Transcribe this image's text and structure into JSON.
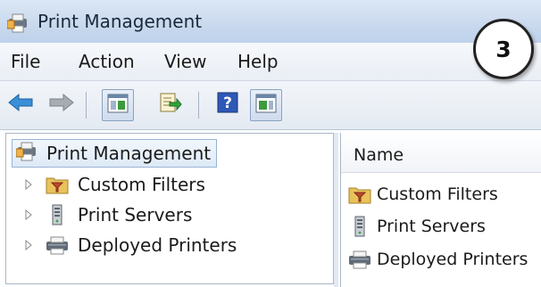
{
  "window": {
    "title": "Print Management"
  },
  "badge": {
    "number": "3"
  },
  "menu": {
    "items": [
      "File",
      "Action",
      "View",
      "Help"
    ]
  },
  "toolbar": {
    "buttons": [
      "back-arrow-icon",
      "forward-arrow-icon",
      "show-hide-console-tree-icon",
      "export-list-icon",
      "help-icon",
      "show-hide-action-pane-icon"
    ]
  },
  "tree": {
    "root": "Print Management",
    "children": [
      "Custom Filters",
      "Print Servers",
      "Deployed Printers"
    ]
  },
  "list": {
    "column_header": "Name",
    "items": [
      "Custom Filters",
      "Print Servers",
      "Deployed Printers"
    ]
  },
  "colors": {
    "titlebar": "#c9d9ee",
    "back_arrow": "#3a8fd8",
    "selection_border": "#99b4d6"
  }
}
